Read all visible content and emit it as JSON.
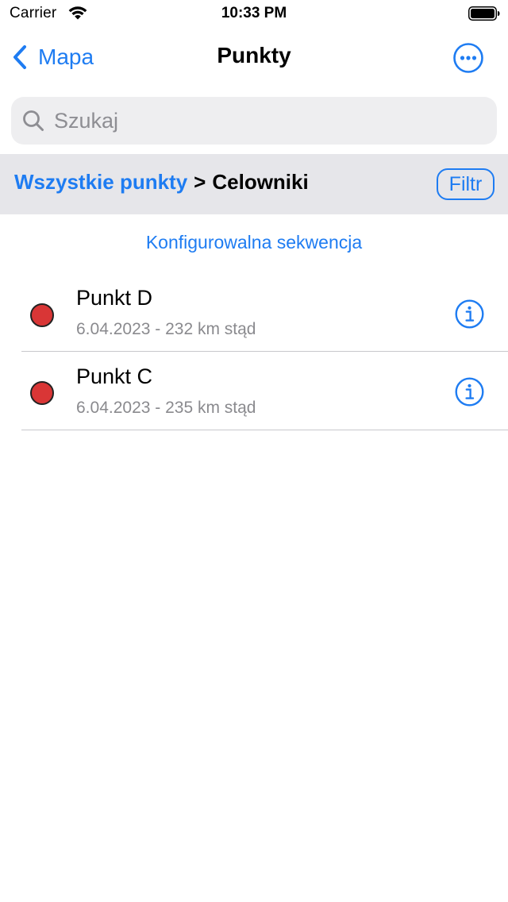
{
  "status_bar": {
    "carrier": "Carrier",
    "time": "10:33 PM"
  },
  "nav": {
    "back_label": "Mapa",
    "title": "Punkty"
  },
  "search": {
    "placeholder": "Szukaj",
    "value": ""
  },
  "breadcrumb": {
    "root": "Wszystkie punkty",
    "separator": ">",
    "current": "Celowniki",
    "filter_label": "Filtr"
  },
  "sequence_link": "Konfigurowalna sekwencja",
  "points": [
    {
      "name": "Punkt D",
      "detail": "6.04.2023 - 232 km stąd",
      "color": "#d93636"
    },
    {
      "name": "Punkt C",
      "detail": "6.04.2023 - 235 km stąd",
      "color": "#d93636"
    }
  ],
  "colors": {
    "accent": "#1e7cf2",
    "marker": "#d93636"
  }
}
